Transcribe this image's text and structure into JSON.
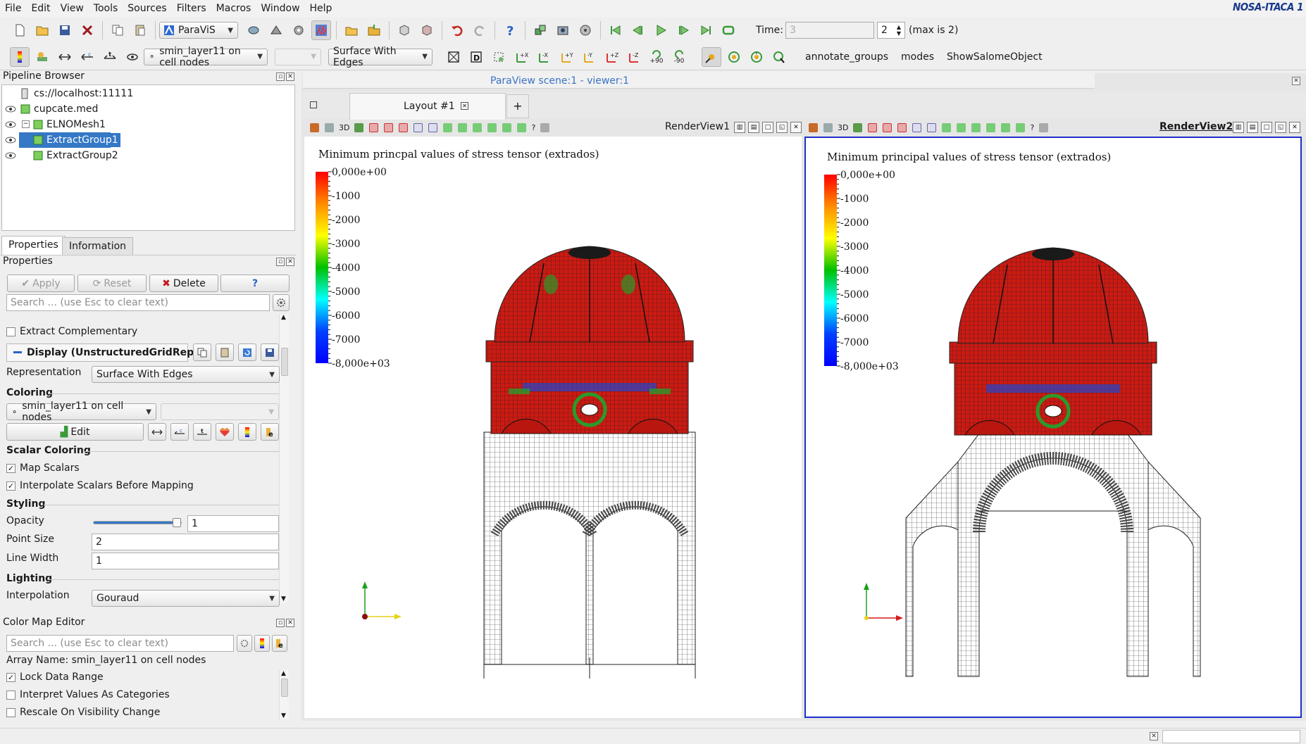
{
  "menu": {
    "items": [
      "File",
      "Edit",
      "View",
      "Tools",
      "Sources",
      "Filters",
      "Macros",
      "Window",
      "Help"
    ],
    "brand": "NOSA-ITACA 1"
  },
  "toolbar1": {
    "module_combo": "ParaViS",
    "time_label": "Time:",
    "time_value": "3",
    "time_index": "2",
    "time_max": "(max is 2)"
  },
  "toolbar2": {
    "color_by": "smin_layer11 on cell nodes",
    "component": "",
    "representation": "Surface With Edges",
    "rot_plus": "+90",
    "rot_minus": "-90",
    "macro_buttons": [
      "annotate_groups",
      "modes",
      "ShowSalomeObject"
    ]
  },
  "pipeline": {
    "title": "Pipeline Browser",
    "items": [
      {
        "label": "cs://localhost:11111",
        "level": 1,
        "eye": false,
        "selected": false
      },
      {
        "label": "cupcate.med",
        "level": 0,
        "eye": true,
        "selected": false
      },
      {
        "label": "ELNOMesh1",
        "level": 1,
        "eye": true,
        "selected": false
      },
      {
        "label": "ExtractGroup1",
        "level": 2,
        "eye": true,
        "selected": true
      },
      {
        "label": "ExtractGroup2",
        "level": 2,
        "eye": true,
        "selected": false
      }
    ]
  },
  "tabs": {
    "properties": "Properties",
    "information": "Information"
  },
  "properties": {
    "title": "Properties",
    "apply": "Apply",
    "reset": "Reset",
    "delete": "Delete",
    "help": "?",
    "search_placeholder": "Search ... (use Esc to clear text)",
    "extract_complementary": "Extract Complementary",
    "display_header": "Display (UnstructuredGridRepre",
    "representation_label": "Representation",
    "representation_value": "Surface With Edges",
    "coloring_section": "Coloring",
    "color_by": "smin_layer11 on cell nodes",
    "edit": "Edit",
    "scalar_coloring_section": "Scalar Coloring",
    "map_scalars": "Map Scalars",
    "interpolate_scalars": "Interpolate Scalars Before Mapping",
    "styling_section": "Styling",
    "opacity_label": "Opacity",
    "opacity_value": "1",
    "opacity_fraction": 1.0,
    "point_size_label": "Point Size",
    "point_size_value": "2",
    "line_width_label": "Line Width",
    "line_width_value": "1",
    "lighting_section": "Lighting",
    "interpolation_label": "Interpolation",
    "interpolation_value": "Gouraud"
  },
  "colormap": {
    "title": "Color Map Editor",
    "search_placeholder": "Search ... (use Esc to clear text)",
    "array_name": "Array Name: smin_layer11 on cell nodes",
    "lock_data_range": "Lock Data Range",
    "interpret_categories": "Interpret Values As Categories",
    "rescale_visibility": "Rescale On Visibility Change"
  },
  "viewer": {
    "scene_title": "ParaView scene:1 - viewer:1",
    "layout_tab": "Layout #1",
    "add_tab": "+",
    "view1_name": "RenderView1",
    "view2_name": "RenderView2",
    "view_toolbar_3d": "3D",
    "view_toolbar_help": "?"
  },
  "colorbar": {
    "view1_title": "Minimum princpal values of stress tensor (extrados)",
    "view2_title": "Minimum principal values of stress tensor (extrados)",
    "ticks": [
      "0,000e+00",
      "-1000",
      "-2000",
      "-3000",
      "-4000",
      "-5000",
      "-6000",
      "-7000",
      "-8,000e+03"
    ],
    "range": [
      -8000,
      0
    ],
    "colors": [
      "#ff0000",
      "#ff8c00",
      "#ffff00",
      "#00c000",
      "#00ffff",
      "#0040ff",
      "#0000ff"
    ]
  },
  "colors": {
    "accent": "#3478c6",
    "mesh_red": "#cc1a12",
    "mesh_line": "#2a2a2a",
    "active_view_border": "#1c2fc8"
  }
}
